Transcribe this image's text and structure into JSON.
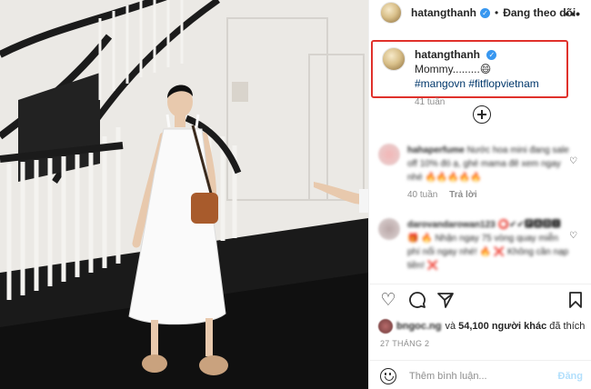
{
  "post": {
    "username": "hatangthanh",
    "follow_status": "Đang theo dõi",
    "more_label": "•••"
  },
  "caption": {
    "username": "hatangthanh",
    "text": "Mommy.........😄",
    "hashtags": "#mangovn #fitflopvietnam",
    "age": "41 tuần"
  },
  "comments": [
    {
      "username": "hahaperfume",
      "text": "Nước hoa mini đang sale off 10% đó ạ, ghé mama đê xem ngay nhé 🔥🔥🔥🔥🔥",
      "age": "40 tuần",
      "reply_label": "Trả lời"
    },
    {
      "username": "darovandarowan123",
      "text": "⭕✔✔🅿🅰🅳🅸 🎁 🔥 Nhận ngay 75 vòng quay miễn phí nổi ngay nhé! 🔥 ❌ Không cần nạp tiền! ❌"
    }
  ],
  "likes": {
    "first_liker": "bngoc.ng",
    "connector": "và",
    "count_text": "54,100 người khác",
    "suffix": "đã thích"
  },
  "date": "27 THÁNG 2",
  "comment_input": {
    "placeholder": "Thêm bình luận...",
    "post_label": "Đăng"
  },
  "icons": {
    "verified": "verified-badge-icon",
    "heart": "heart-icon",
    "comment": "comment-icon",
    "share": "share-icon",
    "save": "bookmark-icon",
    "add": "plus-circle-icon",
    "emoji": "emoji-icon"
  },
  "colors": {
    "highlight_border": "#e0312b",
    "hashtag": "#00376b",
    "verified": "#3897f0",
    "muted": "#8e8e8e",
    "post_button": "#b2dffc"
  }
}
